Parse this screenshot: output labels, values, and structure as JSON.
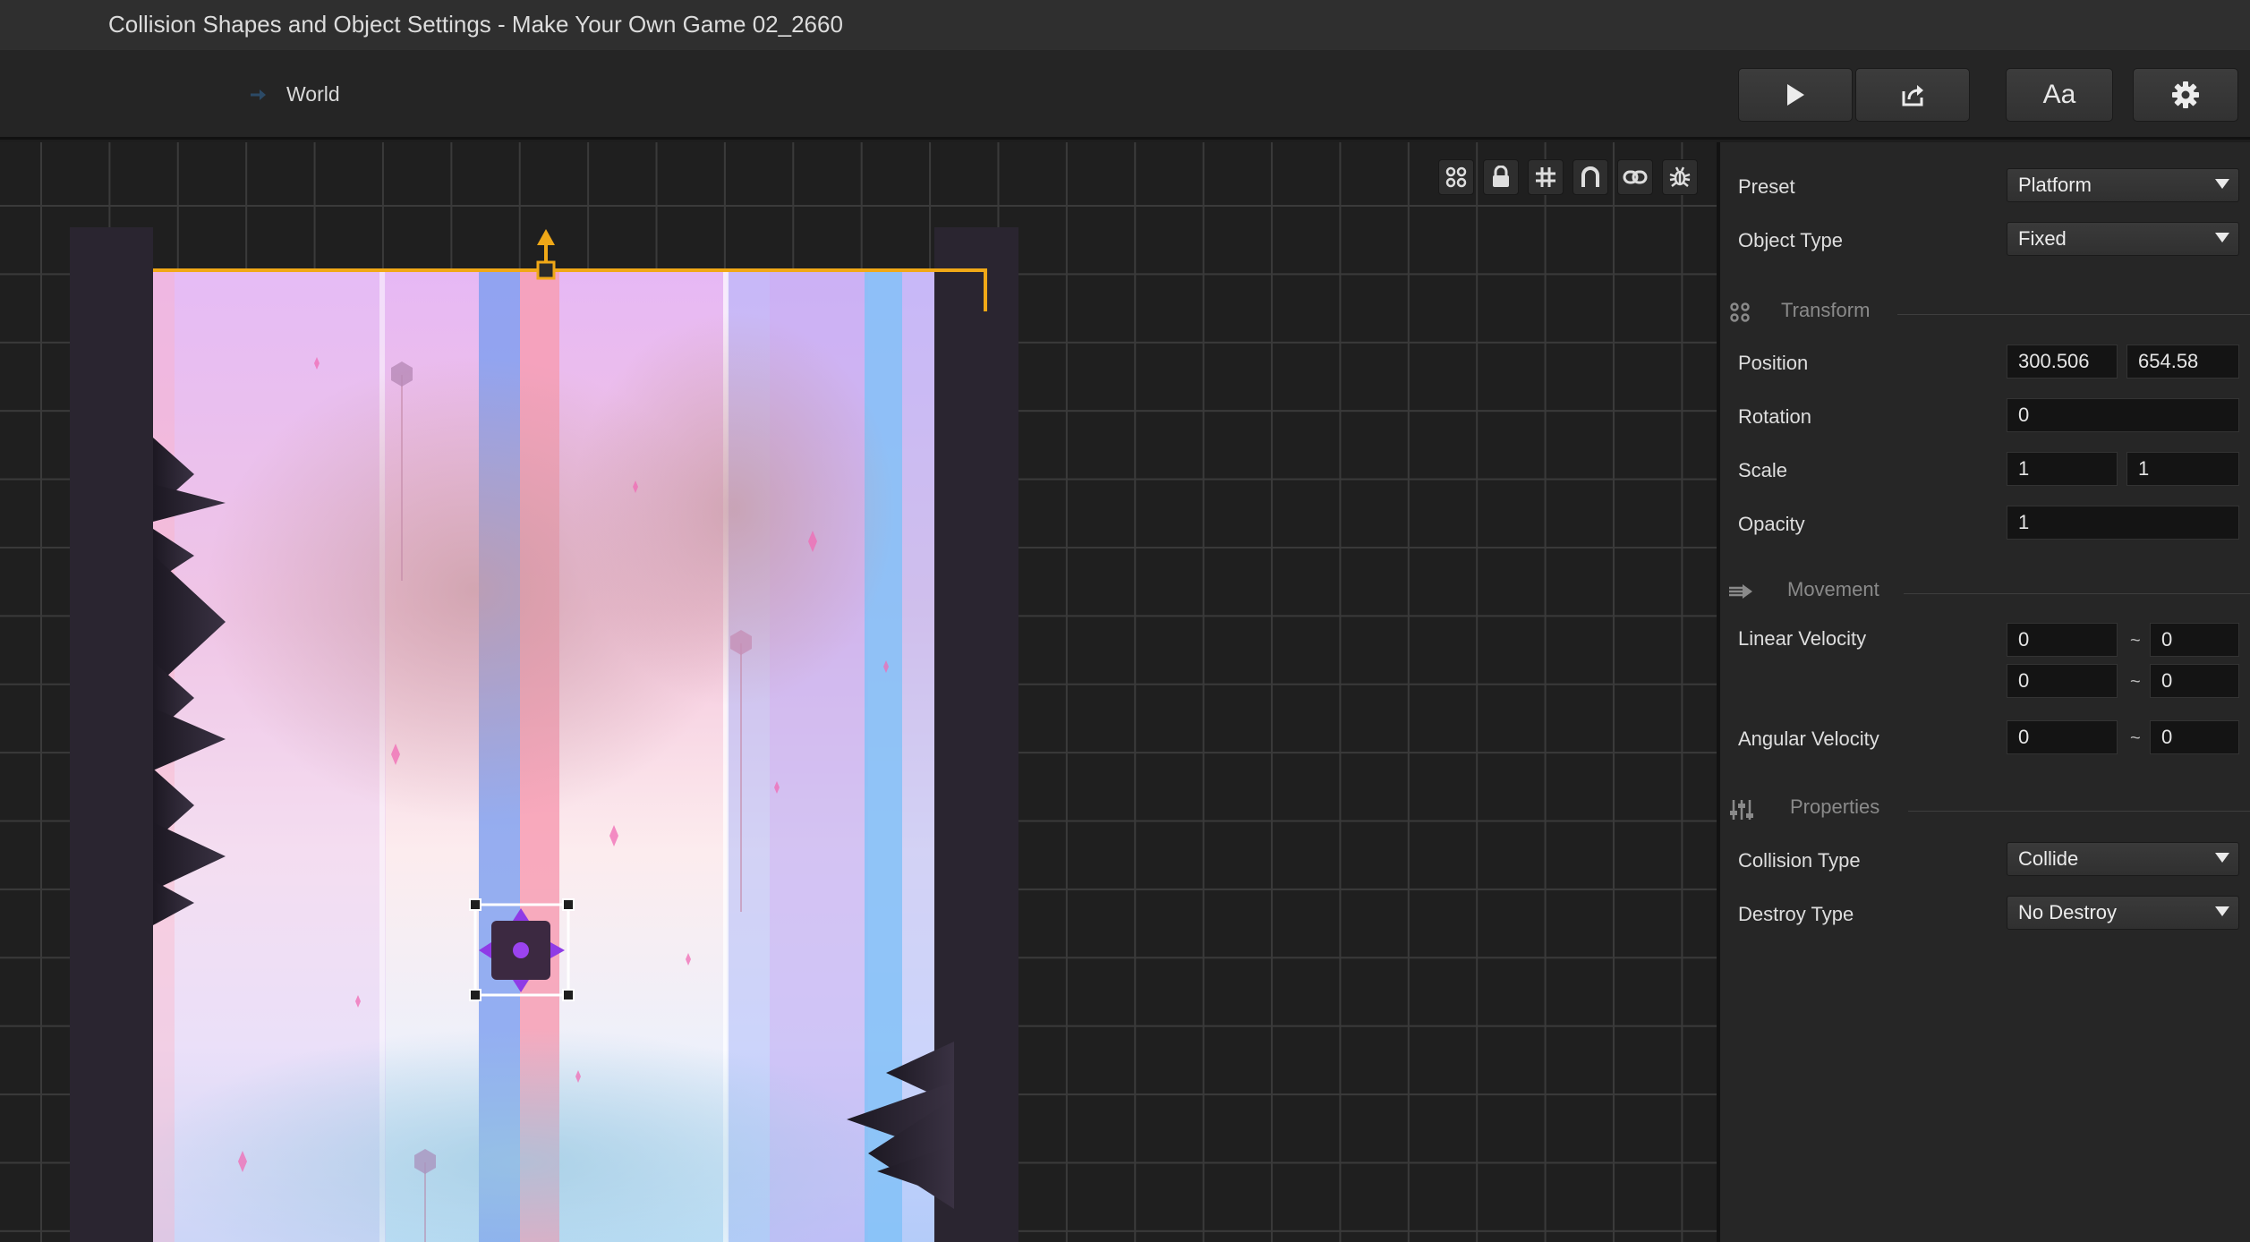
{
  "window": {
    "title": "Collision Shapes and Object Settings - Make Your Own Game 02_2660"
  },
  "breadcrumb": {
    "label": "World"
  },
  "toolbar": {
    "font_label": "Aa"
  },
  "panel": {
    "preset": {
      "label": "Preset",
      "value": "Platform"
    },
    "object_type": {
      "label": "Object Type",
      "value": "Fixed"
    },
    "transform": {
      "title": "Transform",
      "position": {
        "label": "Position",
        "x": "300.506",
        "y": "654.58"
      },
      "rotation": {
        "label": "Rotation",
        "value": "0"
      },
      "scale": {
        "label": "Scale",
        "x": "1",
        "y": "1"
      },
      "opacity": {
        "label": "Opacity",
        "value": "1"
      }
    },
    "movement": {
      "title": "Movement",
      "linear_velocity": {
        "label": "Linear Velocity",
        "x_min": "0",
        "x_max": "0",
        "y_min": "0",
        "y_max": "0"
      },
      "angular_velocity": {
        "label": "Angular Velocity",
        "min": "0",
        "max": "0"
      },
      "tilde": "~"
    },
    "properties": {
      "title": "Properties",
      "collision_type": {
        "label": "Collision Type",
        "value": "Collide"
      },
      "destroy_type": {
        "label": "Destroy Type",
        "value": "No Destroy"
      }
    }
  },
  "colors": {
    "accent": "#f0a817",
    "selection": "#ffffff",
    "spike": "#2a2333",
    "wall": "#2a2530"
  },
  "icons": {
    "toolbar": [
      "play-icon",
      "share-icon",
      "font-icon",
      "gear-icon"
    ],
    "viewport_tools": [
      "group-icon",
      "lock-icon",
      "grid-icon",
      "magnet-icon",
      "link-icon",
      "debug-icon"
    ],
    "sections": [
      "transform-icon",
      "movement-icon",
      "properties-icon"
    ]
  }
}
